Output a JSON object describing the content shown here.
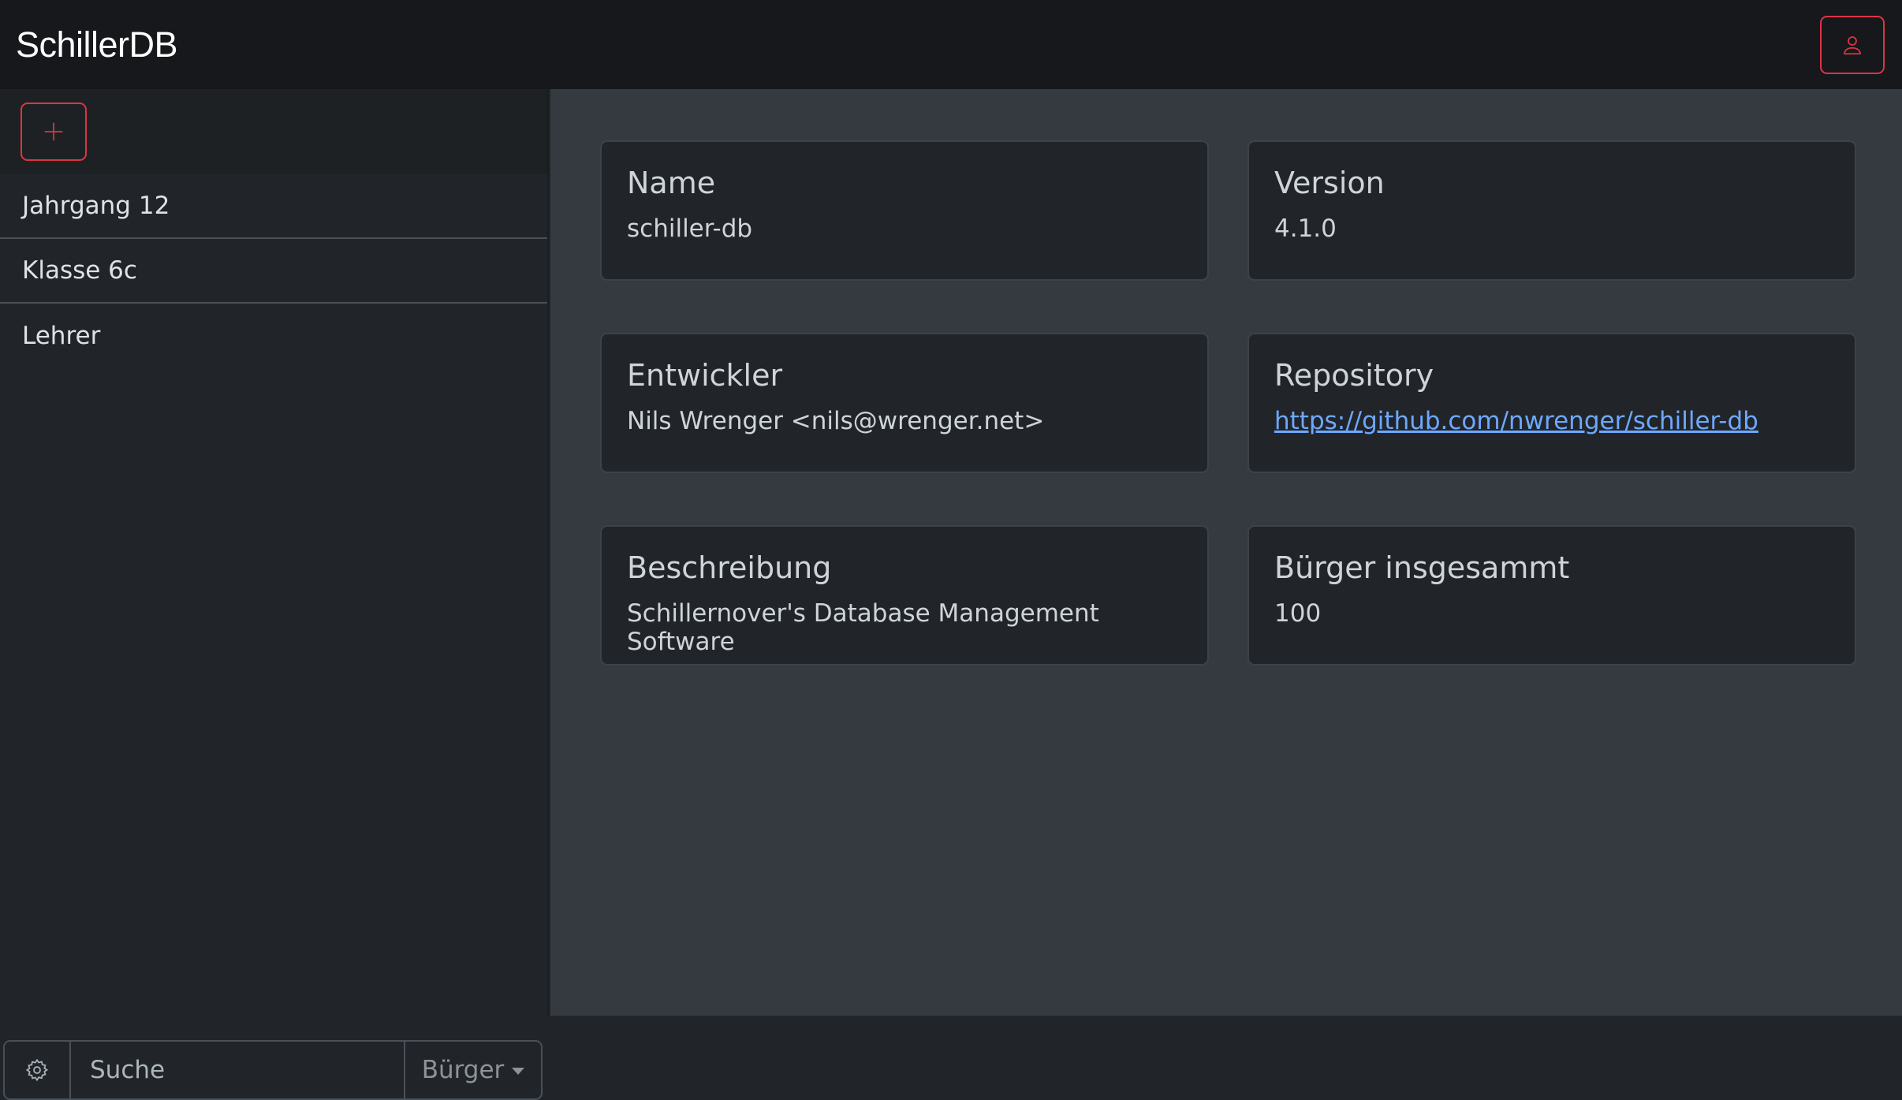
{
  "navbar": {
    "brand": "SchillerDB",
    "user_icon": "person-icon",
    "accent_color": "#dc3545"
  },
  "sidebar": {
    "add_icon": "plus-icon",
    "groups": [
      {
        "label": "Jahrgang 12"
      },
      {
        "label": "Klasse 6c"
      },
      {
        "label": "Lehrer"
      }
    ],
    "search": {
      "settings_icon": "gear-icon",
      "placeholder": "Suche",
      "value": "",
      "type_label": "Bürger"
    }
  },
  "main": {
    "cards": [
      {
        "title": "Name",
        "value": "schiller-db"
      },
      {
        "title": "Version",
        "value": "4.1.0"
      },
      {
        "title": "Entwickler",
        "value": "Nils Wrenger <nils@wrenger.net>"
      },
      {
        "title": "Repository",
        "value": "https://github.com/nwrenger/schiller-db"
      },
      {
        "title": "Beschreibung",
        "value": "Schillernover's Database Management Software"
      },
      {
        "title": "Bürger insgesammt",
        "value": "100"
      }
    ]
  }
}
